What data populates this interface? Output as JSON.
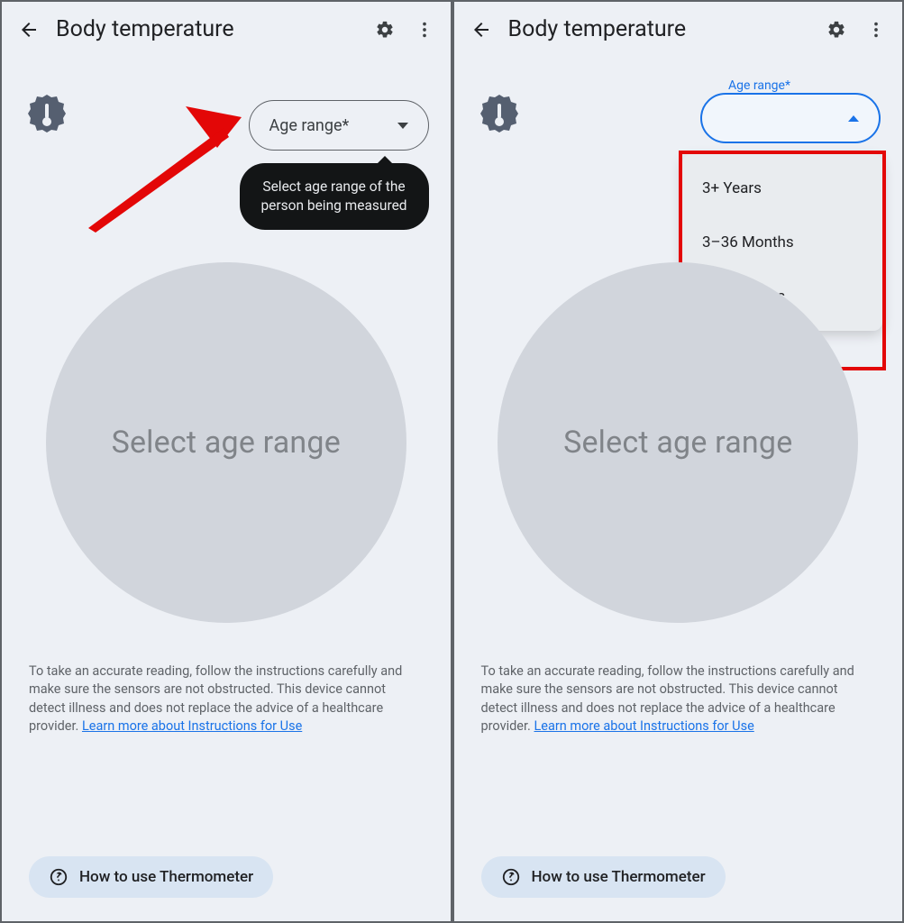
{
  "header": {
    "title": "Body temperature"
  },
  "age_selector": {
    "label": "Age range*",
    "float_label": "Age range*",
    "tooltip": "Select age range of the person being measured",
    "options": [
      "3+ Years",
      "3–36 Months",
      "0–3 Months"
    ]
  },
  "main": {
    "placeholder": "Select age range",
    "instructions_pre": "To take an accurate reading, follow the instructions carefully and make sure the sensors are not obstructed. This device cannot detect illness and does not replace the advice of a healthcare provider. ",
    "instructions_link": "Learn more about Instructions for Use"
  },
  "footer": {
    "howto": "How to use Thermometer"
  }
}
